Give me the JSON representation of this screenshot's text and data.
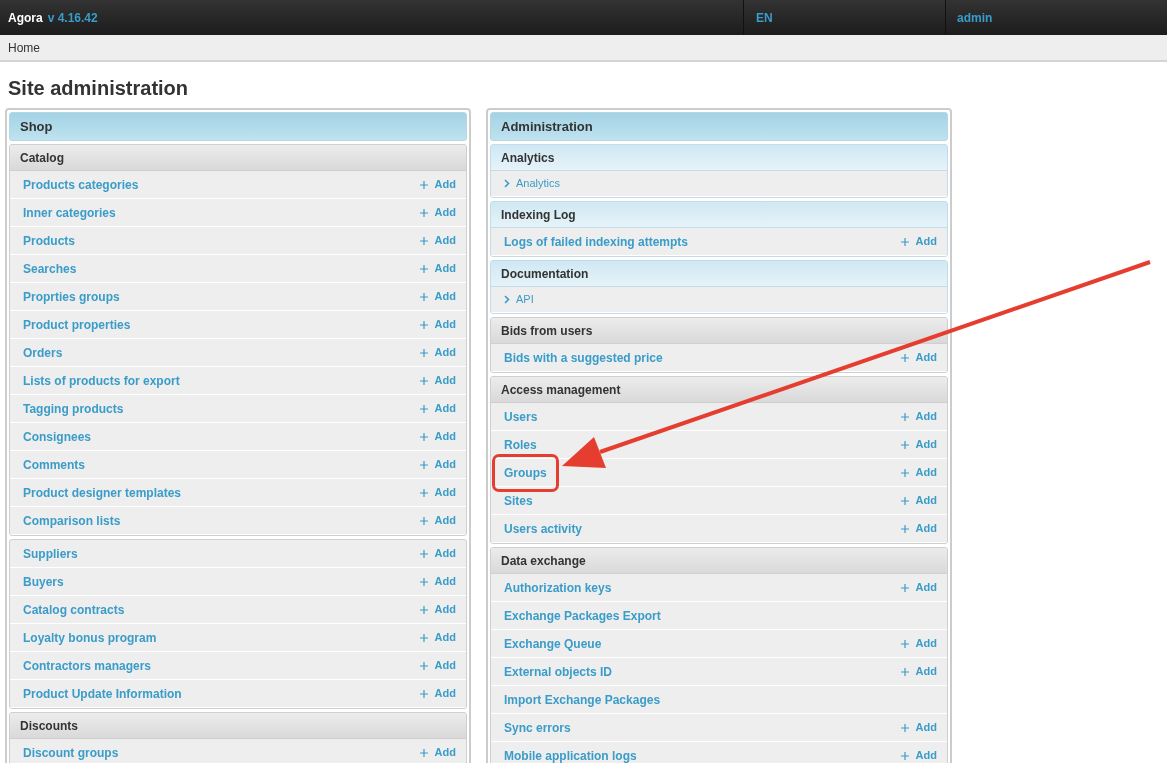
{
  "topbar": {
    "brand": "Agora",
    "version": "v 4.16.42",
    "language": "EN",
    "user": "admin"
  },
  "breadcrumb": [
    "Home"
  ],
  "title": "Site administration",
  "panels": [
    {
      "title": "Shop",
      "sections": [
        {
          "title": "Catalog",
          "kind": "gray",
          "rows": [
            {
              "kind": "link",
              "label": "Products categories",
              "add": "Add"
            },
            {
              "kind": "link",
              "label": "Inner categories",
              "add": "Add"
            },
            {
              "kind": "link",
              "label": "Products",
              "add": "Add"
            },
            {
              "kind": "link",
              "label": "Searches",
              "add": "Add"
            },
            {
              "kind": "link",
              "label": "Proprties groups",
              "add": "Add"
            },
            {
              "kind": "link",
              "label": "Product properties",
              "add": "Add"
            },
            {
              "kind": "link",
              "label": "Orders",
              "add": "Add"
            },
            {
              "kind": "link",
              "label": "Lists of products for export",
              "add": "Add"
            },
            {
              "kind": "link",
              "label": "Tagging products",
              "add": "Add"
            },
            {
              "kind": "link",
              "label": "Consignees",
              "add": "Add"
            },
            {
              "kind": "link",
              "label": "Comments",
              "add": "Add"
            },
            {
              "kind": "link",
              "label": "Product designer templates",
              "add": "Add"
            },
            {
              "kind": "link",
              "label": "Comparison lists",
              "add": "Add"
            }
          ]
        },
        {
          "kind": "gray",
          "rows": [
            {
              "kind": "link",
              "label": "Suppliers",
              "add": "Add"
            },
            {
              "kind": "link",
              "label": "Buyers",
              "add": "Add"
            },
            {
              "kind": "link",
              "label": "Catalog contracts",
              "add": "Add"
            },
            {
              "kind": "link",
              "label": "Loyalty bonus program",
              "add": "Add"
            },
            {
              "kind": "link",
              "label": "Contractors managers",
              "add": "Add"
            },
            {
              "kind": "link",
              "label": "Product Update Information",
              "add": "Add"
            }
          ]
        },
        {
          "title": "Discounts",
          "kind": "gray",
          "rows": [
            {
              "kind": "link",
              "label": "Discount groups",
              "add": "Add"
            }
          ]
        }
      ]
    },
    {
      "title": "Administration",
      "sections": [
        {
          "title": "Analytics",
          "kind": "blue",
          "rows": [
            {
              "kind": "sublink",
              "label": "Analytics"
            }
          ]
        },
        {
          "title": "Indexing Log",
          "kind": "blue",
          "rows": [
            {
              "kind": "link",
              "label": "Logs of failed indexing attempts",
              "add": "Add"
            }
          ]
        },
        {
          "title": "Documentation",
          "kind": "blue",
          "rows": [
            {
              "kind": "sublink",
              "label": "API"
            }
          ]
        },
        {
          "title": "Bids from users",
          "kind": "gray",
          "rows": [
            {
              "kind": "link",
              "label": "Bids with a suggested price",
              "add": "Add"
            }
          ]
        },
        {
          "title": "Access management",
          "kind": "gray",
          "rows": [
            {
              "kind": "link",
              "label": "Users",
              "add": "Add",
              "highlighted": false
            },
            {
              "kind": "link",
              "label": "Roles",
              "add": "Add",
              "highlighted": false
            },
            {
              "kind": "link",
              "label": "Groups",
              "add": "Add",
              "highlighted": true
            },
            {
              "kind": "link",
              "label": "Sites",
              "add": "Add",
              "highlighted": false
            },
            {
              "kind": "link",
              "label": "Users activity",
              "add": "Add",
              "highlighted": false
            }
          ]
        },
        {
          "title": "Data exchange",
          "kind": "gray",
          "rows": [
            {
              "kind": "link",
              "label": "Authorization keys",
              "add": "Add"
            },
            {
              "kind": "link",
              "label": "Exchange Packages Export"
            },
            {
              "kind": "link",
              "label": "Exchange Queue",
              "add": "Add"
            },
            {
              "kind": "link",
              "label": "External objects ID",
              "add": "Add"
            },
            {
              "kind": "link",
              "label": "Import Exchange Packages"
            },
            {
              "kind": "link",
              "label": "Sync errors",
              "add": "Add"
            },
            {
              "kind": "link",
              "label": "Mobile application logs",
              "add": "Add"
            }
          ]
        }
      ]
    }
  ]
}
